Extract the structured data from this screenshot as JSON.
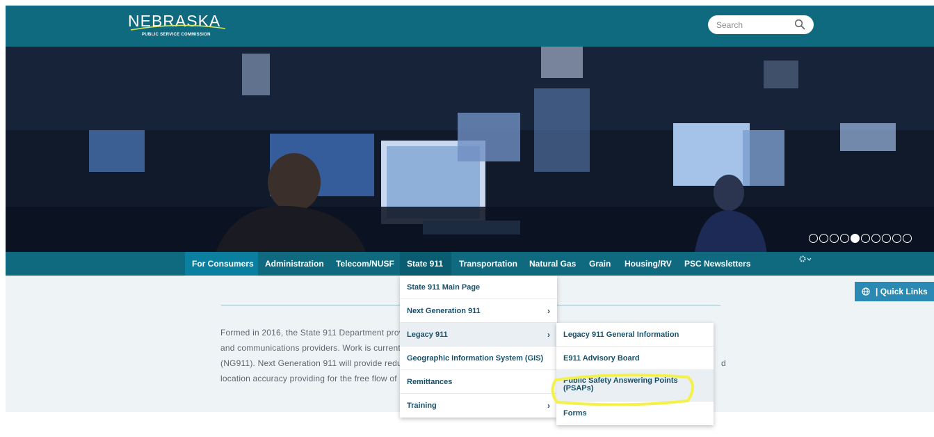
{
  "header": {
    "logo_title": "NEBRASKA",
    "logo_subtitle": "PUBLIC SERVICE COMMISSION",
    "search_placeholder": "Search"
  },
  "hero": {
    "slide_count": 10,
    "active_slide": 5
  },
  "nav": {
    "items": [
      {
        "label": "For Consumers"
      },
      {
        "label": "Administration"
      },
      {
        "label": "Telecom/NUSF"
      },
      {
        "label": "State 911"
      },
      {
        "label": "Transportation"
      },
      {
        "label": "Natural Gas"
      },
      {
        "label": "Grain"
      },
      {
        "label": "Housing/RV"
      },
      {
        "label": "PSC Newsletters"
      }
    ],
    "settings_icon": "gear-icon"
  },
  "quick_links": {
    "label": "| Quick Links",
    "icon": "globe-icon"
  },
  "content": {
    "lines": [
      "Formed in 2016, the State 911 Department prov",
      "and communications providers. Work is currentl",
      "(NG911). Next Generation 911 will provide redur",
      "location accuracy providing for the free flow of"
    ],
    "line3_tail": "d"
  },
  "menu_state911": {
    "items": [
      {
        "label": "State 911 Main Page",
        "has_submenu": false
      },
      {
        "label": "Next Generation 911",
        "has_submenu": true
      },
      {
        "label": "Legacy 911",
        "has_submenu": true
      },
      {
        "label": "Geographic Information System (GIS)",
        "has_submenu": false
      },
      {
        "label": "Remittances",
        "has_submenu": false
      },
      {
        "label": "Training",
        "has_submenu": true
      }
    ],
    "chevron": "›"
  },
  "menu_legacy911": {
    "items": [
      {
        "label": "Legacy 911 General Information"
      },
      {
        "label": "E911 Advisory Board"
      },
      {
        "label": "Public Safety Answering Points (PSAPs)"
      },
      {
        "label": "Forms"
      }
    ]
  },
  "colors": {
    "header": "#0f6a80",
    "nav_highlight": "#0b7fa0",
    "quick_links": "#2b8ab4",
    "annotation": "#f4f14a"
  }
}
